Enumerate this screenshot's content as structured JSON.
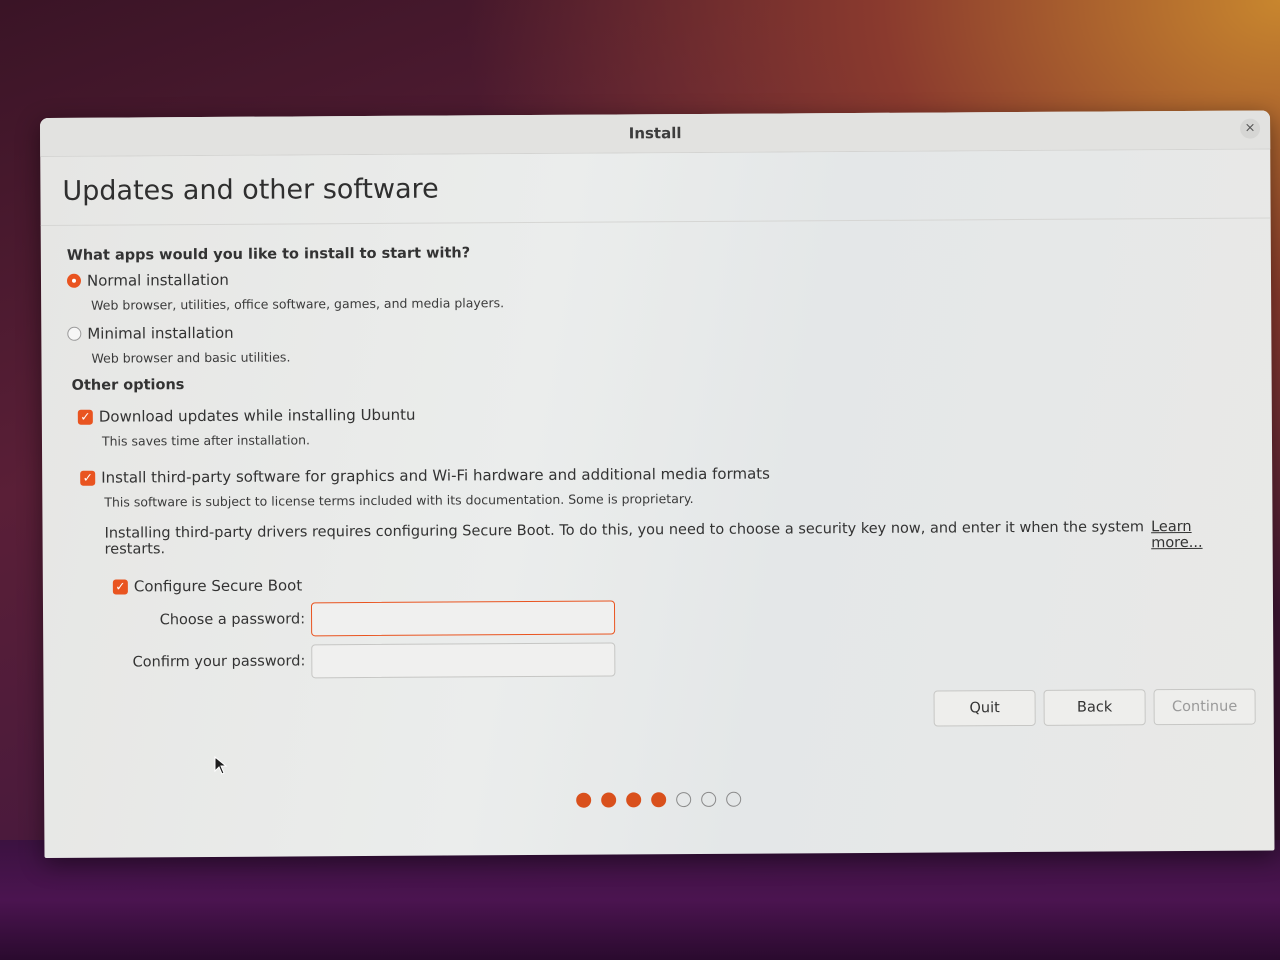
{
  "window": {
    "title": "Install",
    "close_glyph": "×"
  },
  "page": {
    "title": "Updates and other software"
  },
  "apps": {
    "question": "What apps would you like to install to start with?",
    "options": [
      {
        "label": "Normal installation",
        "description": "Web browser, utilities, office software, games, and media players.",
        "selected": true
      },
      {
        "label": "Minimal installation",
        "description": "Web browser and basic utilities.",
        "selected": false
      }
    ]
  },
  "other": {
    "title": "Other options",
    "download_updates": {
      "label": "Download updates while installing Ubuntu",
      "description": "This saves time after installation.",
      "checked": true
    },
    "third_party": {
      "label": "Install third-party software for graphics and Wi-Fi hardware and additional media formats",
      "description": "This software is subject to license terms included with its documentation. Some is proprietary.",
      "checked": true
    },
    "secure_boot_note": "Installing third-party drivers requires configuring Secure Boot. To do this, you need to choose a security key now, and enter it when the system restarts.",
    "learn_more": "Learn more...",
    "secure_boot": {
      "label": "Configure Secure Boot",
      "checked": true
    },
    "password_label": "Choose a password:",
    "password_value": "",
    "confirm_label": "Confirm your password:",
    "confirm_value": ""
  },
  "buttons": {
    "quit": "Quit",
    "back": "Back",
    "continue": "Continue"
  },
  "progress": {
    "completed_steps": 4,
    "total_steps": 7
  },
  "colors": {
    "accent": "#e95420"
  },
  "icons": {
    "check": "✓"
  }
}
